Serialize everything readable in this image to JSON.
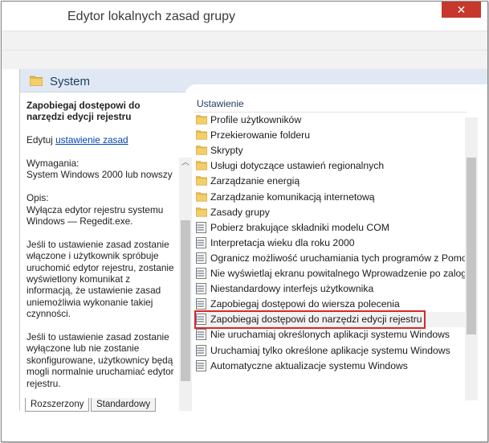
{
  "window": {
    "title": "Edytor lokalnych zasad grupy",
    "close_glyph": "✕"
  },
  "header": {
    "title": "System"
  },
  "description": {
    "policy_title": "Zapobiegaj dostępowi do narzędzi edycji rejestru",
    "edit_prefix": "Edytuj",
    "edit_link": "ustawienie zasad",
    "requirements_label": "Wymagania:",
    "requirements_value": "System Windows 2000 lub nowszy",
    "opis_label": "Opis:",
    "opis_text": "Wyłącza edytor rejestru systemu Windows — Regedit.exe.",
    "para1": "Jeśli to ustawienie zasad zostanie włączone i użytkownik spróbuje uruchomić edytor rejestru, zostanie wyświetlony komunikat z informacją, że ustawienie zasad uniemożliwia wykonanie takiej czynności.",
    "para2": "Jeśli to ustawienie zasad zostanie wyłączone lub nie zostanie skonfigurowane, użytkownicy będą mogli normalnie uruchamiać edytor rejestru."
  },
  "list": {
    "column_header": "Ustawienie",
    "items": [
      {
        "label": "Profile użytkowników",
        "icon": "folder-icon"
      },
      {
        "label": "Przekierowanie folderu",
        "icon": "folder-icon"
      },
      {
        "label": "Skrypty",
        "icon": "folder-icon"
      },
      {
        "label": "Usługi dotyczące ustawień regionalnych",
        "icon": "folder-icon"
      },
      {
        "label": "Zarządzanie energią",
        "icon": "folder-icon"
      },
      {
        "label": "Zarządzanie komunikacją internetową",
        "icon": "folder-icon"
      },
      {
        "label": "Zasady grupy",
        "icon": "folder-icon"
      },
      {
        "label": "Pobierz brakujące składniki modelu COM",
        "icon": "policy-icon"
      },
      {
        "label": "Interpretacja wieku dla roku 2000",
        "icon": "policy-icon"
      },
      {
        "label": "Ogranicz możliwość uruchamiania tych programów z Pomocy",
        "icon": "policy-icon"
      },
      {
        "label": "Nie wyświetlaj ekranu powitalnego Wprowadzenie po zalogowaniu",
        "icon": "policy-icon"
      },
      {
        "label": "Niestandardowy interfejs użytkownika",
        "icon": "policy-icon"
      },
      {
        "label": "Zapobiegaj dostępowi do wiersza polecenia",
        "icon": "policy-icon"
      },
      {
        "label": "Zapobiegaj dostępowi do narzędzi edycji rejestru",
        "icon": "policy-icon"
      },
      {
        "label": "Nie uruchamiaj określonych aplikacji systemu Windows",
        "icon": "policy-icon"
      },
      {
        "label": "Uruchamiaj tylko określone aplikacje systemu Windows",
        "icon": "policy-icon"
      },
      {
        "label": "Automatyczne aktualizacje systemu Windows",
        "icon": "policy-icon"
      }
    ],
    "selected_index": 13
  },
  "tabs": {
    "extended": "Rozszerzony",
    "standard": "Standardowy"
  },
  "scroll": {
    "up_glyph": "︿",
    "down_glyph": "﹀"
  },
  "colors": {
    "highlight": "#d32a2a",
    "close": "#c7372c",
    "header_band": "#dfe8f3"
  }
}
